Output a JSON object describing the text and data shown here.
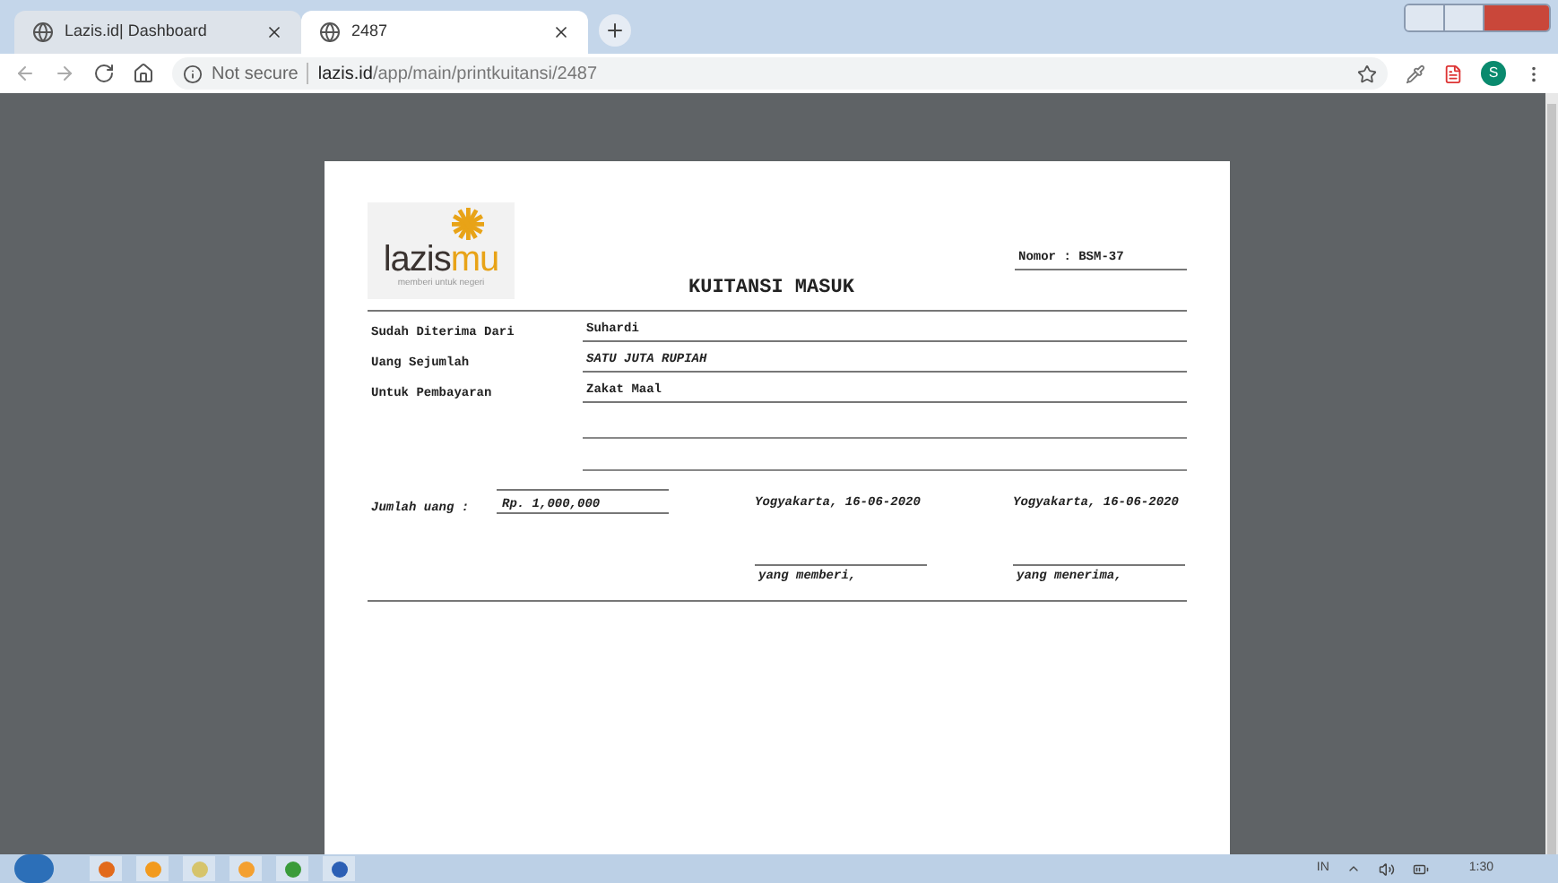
{
  "tabs": [
    {
      "title": "Lazis.id| Dashboard",
      "selected": false
    },
    {
      "title": "2487",
      "selected": true
    }
  ],
  "address_bar": {
    "security": "Not secure",
    "domain": "lazis.id",
    "path": "/app/main/printkuitansi/2487"
  },
  "profile": {
    "initial": "S"
  },
  "receipt": {
    "logo": {
      "name_dark": "lazis",
      "name_accent": "mu",
      "tagline": "memberi untuk negeri"
    },
    "number": "Nomor : BSM-37",
    "title": "KUITANSI MASUK",
    "fields": [
      {
        "label": "Sudah Diterima Dari",
        "value": "Suhardi",
        "italic": false
      },
      {
        "label": "Uang Sejumlah",
        "value": "SATU JUTA  RUPIAH",
        "italic": true
      },
      {
        "label": "Untuk Pembayaran",
        "value": "Zakat Maal",
        "italic": false
      }
    ],
    "amount_label": "Jumlah uang :",
    "amount": "Rp. 1,000,000",
    "signatures": [
      {
        "place_date": "Yogyakarta, 16-06-2020",
        "role": "yang memberi,"
      },
      {
        "place_date": "Yogyakarta, 16-06-2020",
        "role": "yang menerima,"
      }
    ]
  },
  "taskbar": {
    "language": "IN",
    "time": "1:30"
  }
}
